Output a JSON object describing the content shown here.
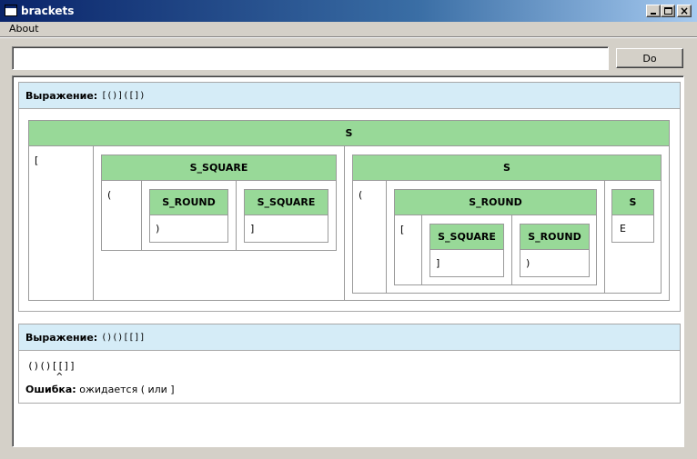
{
  "window": {
    "title": "brackets",
    "menu": [
      "About"
    ]
  },
  "toolbar": {
    "input_value": "",
    "do_label": "Do"
  },
  "results": [
    {
      "label": "Выражение:",
      "expression": "[()]([])",
      "tree": {
        "root": "S",
        "open": "[",
        "square": {
          "label": "S_SQUARE",
          "open": "(",
          "round_label": "S_ROUND",
          "round_text": ")",
          "sq_label": "S_SQUARE",
          "sq_text": "]"
        },
        "s": {
          "label": "S",
          "open": "(",
          "round": {
            "label": "S_ROUND",
            "open": "[",
            "sq_label": "S_SQUARE",
            "sq_text": "]",
            "round_label": "S_ROUND",
            "round_text": ")"
          },
          "s_end": {
            "label": "S",
            "text": "E"
          }
        }
      }
    },
    {
      "label": "Выражение:",
      "expression": "()()[[]]",
      "echo": "()()[[]]",
      "caret": "^",
      "error_label": "Ошибка:",
      "error_text": "ожидается ( или ]"
    }
  ]
}
